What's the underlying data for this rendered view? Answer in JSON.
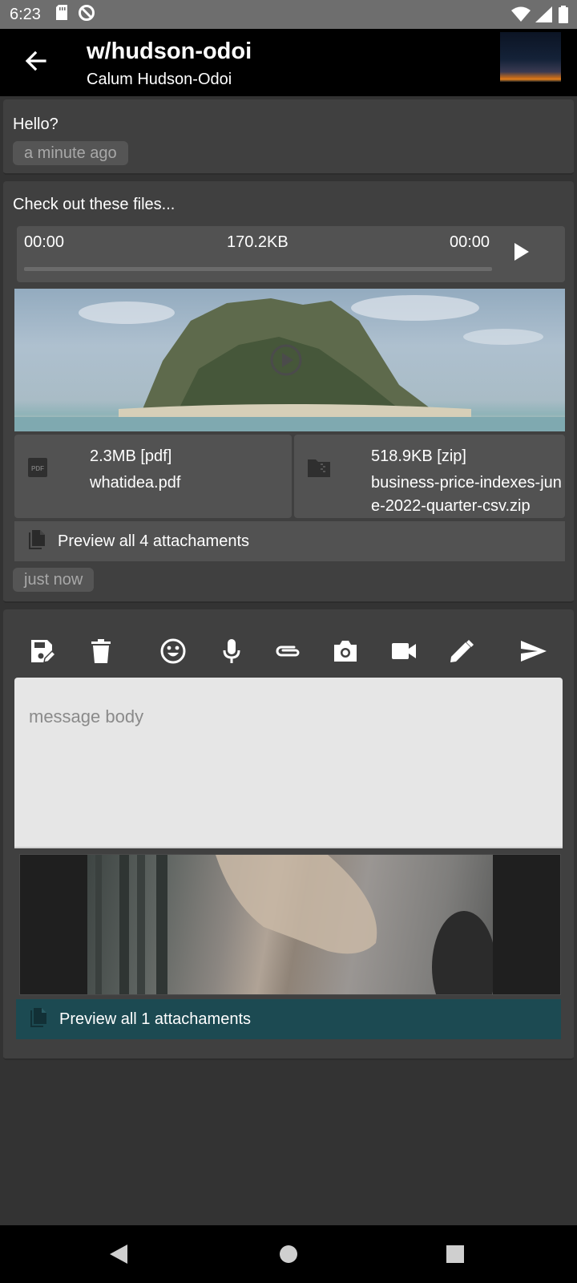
{
  "status_bar": {
    "time": "6:23",
    "icons": [
      "sd-card-icon",
      "data-saver-icon",
      "wifi-icon",
      "signal-icon",
      "battery-icon"
    ]
  },
  "app_bar": {
    "title": "w/hudson-odoi",
    "subtitle": "Calum Hudson-Odoi",
    "back_icon": "arrow-back-icon"
  },
  "messages": [
    {
      "text": "Hello?",
      "time": "a minute ago"
    },
    {
      "text": "Check out these files...",
      "audio": {
        "elapsed": "00:00",
        "size": "170.2KB",
        "duration": "00:00",
        "progress": 0
      },
      "files": [
        {
          "size": "2.3MB [pdf]",
          "name": "whatidea.pdf",
          "icon": "pdf-icon"
        },
        {
          "size": "518.9KB [zip]",
          "name": "business-price-indexes-june-2022-quarter-csv.zip",
          "icon": "zip-folder-icon"
        }
      ],
      "preview_label": "Preview all 4 attachaments",
      "time": "just now"
    }
  ],
  "composer": {
    "tools": [
      "save-draft-icon",
      "delete-icon",
      "emoji-icon",
      "microphone-icon",
      "attach-icon",
      "camera-icon",
      "videocam-icon",
      "edit-icon"
    ],
    "send_icon": "send-icon",
    "placeholder": "message body",
    "value": "",
    "preview_label": "Preview all 1 attachaments"
  },
  "colors": {
    "background": "#333333",
    "card": "#404040",
    "tile": "#525252",
    "preview_teal": "#1c4a52",
    "input": "#e6e6e6"
  },
  "nav_bar": {
    "icons": [
      "back-triangle-icon",
      "home-circle-icon",
      "recents-square-icon"
    ]
  }
}
